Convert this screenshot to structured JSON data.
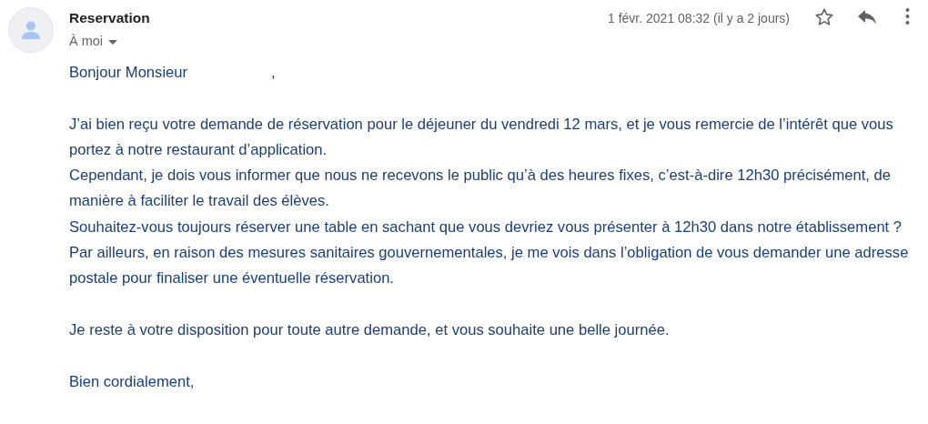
{
  "message": {
    "subject": "Reservation",
    "recipient": "À moi",
    "date": "1 févr. 2021 08:32 (il y a 2 jours)",
    "starred": false
  },
  "body": {
    "greeting": "Bonjour Monsieur",
    "greeting_end": ",",
    "paragraphs": [
      [
        "J’ai bien reçu votre demande de réservation pour le déjeuner du vendredi 12 mars, et je vous remercie de l’intérêt que vous portez à notre restaurant d’application.",
        "Cependant, je dois vous informer que nous ne recevons le public qu’à des heures fixes, c’est-à-dire 12h30 précisément, de manière à faciliter le travail des élèves.",
        "Souhaitez-vous toujours réserver une table en sachant que vous devriez vous présenter à 12h30 dans notre établissement ?",
        "Par ailleurs, en raison des mesures sanitaires gouvernementales, je me vois dans l’obligation de vous demander une adresse postale pour finaliser une éventuelle réservation."
      ],
      [
        "Je reste à votre disposition pour toute autre demande, et vous souhaite une belle journée."
      ],
      [
        "Bien cordialement,"
      ]
    ]
  }
}
